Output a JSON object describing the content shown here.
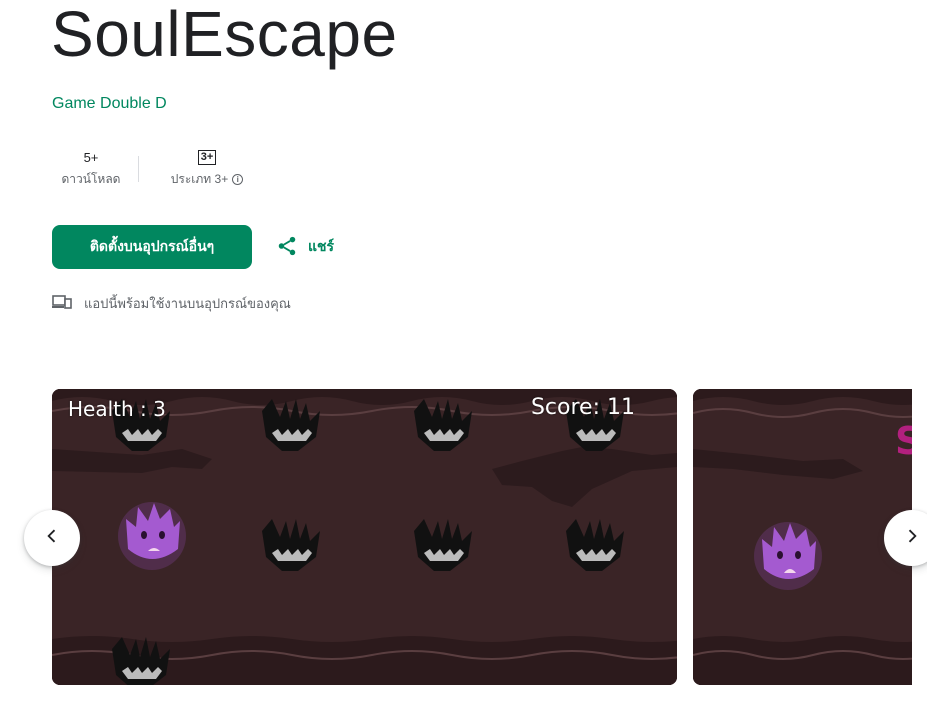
{
  "app": {
    "title": "SoulEscape",
    "developer": "Game Double D"
  },
  "stats": {
    "downloads_value": "5+",
    "downloads_label": "ดาวน์โหลด",
    "rating_badge": "3+",
    "rating_label": "ประเภท 3+"
  },
  "actions": {
    "install_label": "ติดตั้งบนอุปกรณ์อื่นๆ",
    "share_label": "แชร์"
  },
  "availability": {
    "text": "แอปนี้พร้อมใช้งานบนอุปกรณ์ของคุณ"
  },
  "screenshots": [
    {
      "health_text": "Health : 3",
      "score_text": "Score: 11"
    },
    {
      "partial_text": "S"
    }
  ],
  "icons": {
    "info": "info-icon",
    "share": "share-icon",
    "devices": "devices-icon",
    "prev": "chevron-left-icon",
    "next": "chevron-right-icon"
  },
  "colors": {
    "brand_green": "#01875f",
    "text_primary": "#202124",
    "text_secondary": "#5f6368",
    "game_background": "#3a2426",
    "character_purple": "#a45ad0"
  }
}
